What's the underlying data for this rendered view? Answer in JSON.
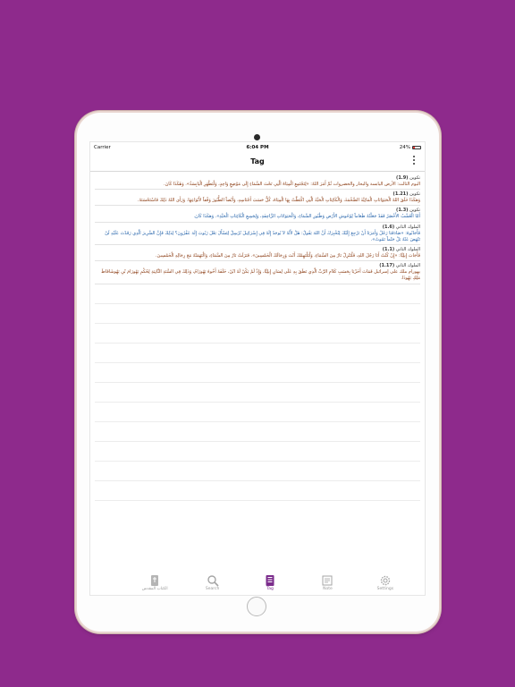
{
  "status": {
    "carrier": "Carrier",
    "time": "6:04 PM",
    "battery": "24%"
  },
  "nav": {
    "title": "Tag"
  },
  "entries": [
    {
      "book": "تكوين",
      "ref": "(1.9)",
      "color": "brown",
      "text": "اليوم الثالث: الأرض اليابسة والبحار والخضروات ثُمَّ أَمَرَ اللهُ: «لِتَجْتَمِعِ الْمِيَاهُ الَّتِي تَحْتَ السَّمَاءِ إِلَى مَوْضِعٍ وَاحِدٍ، وَلْتَظْهَرِ الْيَابِسَةُ». وَهَكَذَا كَانَ."
    },
    {
      "book": "تكوين",
      "ref": "(1.21)",
      "color": "brown",
      "text": "وَهكَذَا خَلَقَ اللهُ الْحَيَوَانَاتِ الْمَائِيَّةَ الضَّخْمَةَ، وَالْكَائِنَاتِ الْحَيَّةَ الَّتِي اكْتَظَّتْ بِهَا الْمِيَاهُ، كُلٌّ حَسَبَ أَجْنَاسِهِ، وَأَيْضاً الطُّيُورَ وَفْقاً لأَنْوَاعِهَا. وَرَأَى اللهُ ذَلِكَ فَاسْتَحْسَنَهُ."
    },
    {
      "book": "تكوين",
      "ref": "(1.3)",
      "color": "blue",
      "text": "أَمَّا الْعُشْبُ الأَخْضَرُ فَقَدْ جَعَلْتُهُ طَعَاماً لِوُحُوشِ الأَرْضِ وَطُيُورِ السَّمَاءِ، وَالْحَيَوَانَاتِ الزَّاحِفَةِ، وَلِجَمِيعِ الْكَائِنَاتِ الْحَيَّةِ». وَهكَذَا كَانَ."
    },
    {
      "book": "الملوك الثاني",
      "ref": "(1.6)",
      "color": "blue",
      "text": "فَأَجَابُوهُ: «صَادَفَنَا رَجُلٌ وَأَمَرَنَا أَنْ نَرْجِعَ إِلَيْكَ لِنُخْبِرَكَ أَنَّ اللهَ يَقُولُ: هَلْ لأَنَّهُ لاَ يُوجَدُ إِلَهٌ فِي إِسْرَائِيلَ تُرْسِلُ لِتَسْأَلَ بَعْلَ زَبُوبَ إِلَهَ عَقْرُونَ؟ لِذَلِكَ فَإِنَّ السَّرِيرَ الَّذِي رَقَدْتَ عَلَيْهِ لَنْ تَنْهَضَ عَنْهُ بَلْ حَتْماً تَمُوتُ»."
    },
    {
      "book": "الملوك الثاني",
      "ref": "(1.1)",
      "color": "brown",
      "text": "فَأَجَابَ إِيلِيَّا: «إِنْ كُنْتُ أَنَا رَجُلَ اللهِ، فَلْتَنْزِلْ نَارٌ مِنَ السَّمَاءِ، وَلْتَلْتَهِمْكَ أَنْتَ وَرِجَالَكَ الْخَمْسِينَ». فَنَزَلَتْ نَارٌ مِنَ السَّمَاءِ، وَالْتَهَمَتْهُ مَعَ رِجَالِهِ الْخَمْسِينَ."
    },
    {
      "book": "الملوك الثاني",
      "ref": "(1.17)",
      "color": "brown",
      "text": "يهورام ملك على إسرائيل فَمَاتَ أَخَزْيَا بِحَسَبِ كَلاَمِ الرَّبِّ الَّذِي نَطَقَ بِهِ عَلَى لِسَانِ إِيلِيَّا، وَإِذْ لَمْ يَكُنْ لَهُ ابْنٌ، خَلَفَهُ أَخُوهُ يَهُورَامُ، وَذَلِكَ فِي السَّنَةِ الثَّانِيَةِ لِحُكْمِ يَهُورَامَ بْنِ يَهُوشَافَاطَ مَلِكِ يَهُوذَا."
    }
  ],
  "tabs": [
    {
      "label": "الكتاب المقدس",
      "icon": "bible-icon",
      "active": false
    },
    {
      "label": "Search",
      "icon": "search-icon",
      "active": false
    },
    {
      "label": "Tag",
      "icon": "tag-icon",
      "active": true
    },
    {
      "label": "Note",
      "icon": "note-icon",
      "active": false
    },
    {
      "label": "Settings",
      "icon": "gear-icon",
      "active": false
    }
  ],
  "colors": {
    "background": "#8e2a8c",
    "accent": "#7b2c8c",
    "verse_brown": "#8a3b12",
    "verse_blue": "#1f5fa8"
  }
}
